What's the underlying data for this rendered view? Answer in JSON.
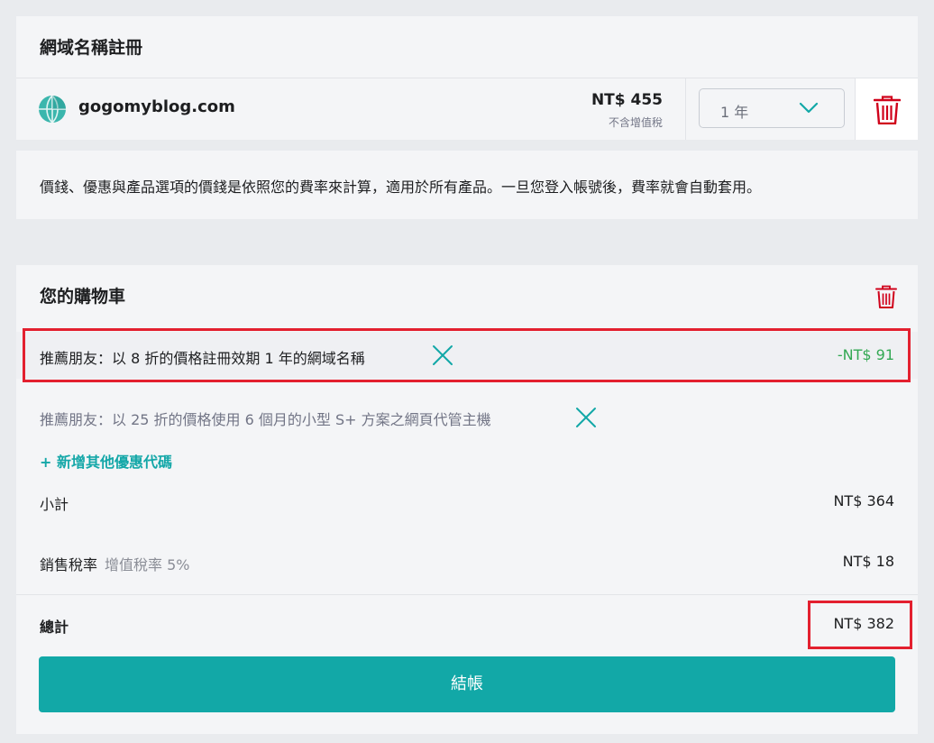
{
  "domain_panel": {
    "title": "網域名稱註冊",
    "domain": "gogomyblog.com",
    "price": "NT$ 455",
    "price_note": "不含增值稅",
    "period": "1 年"
  },
  "notice": "價錢、優惠與產品選項的價錢是依照您的費率來計算，適用於所有產品。一旦您登入帳號後，費率就會自動套用。",
  "cart": {
    "title": "您的購物車",
    "promos": [
      {
        "label": "推薦朋友：以 8 折的價格註冊效期 1 年的網域名稱",
        "amount": "-NT$ 91"
      },
      {
        "label": "推薦朋友：以 25 折的價格使用 6 個月的小型 S+ 方案之網頁代管主機"
      }
    ],
    "add_code": "+ 新增其他優惠代碼",
    "subtotal_label": "小計",
    "subtotal_value": "NT$ 364",
    "tax_label": "銷售稅率",
    "tax_note": "增值稅率 5%",
    "tax_value": "NT$ 18",
    "total_label": "總計",
    "total_value": "NT$ 382",
    "checkout_label": "結帳"
  },
  "colors": {
    "accent": "#12a8a7",
    "discount": "#33a853",
    "highlight": "#e3202f",
    "trash": "#d0021b"
  }
}
